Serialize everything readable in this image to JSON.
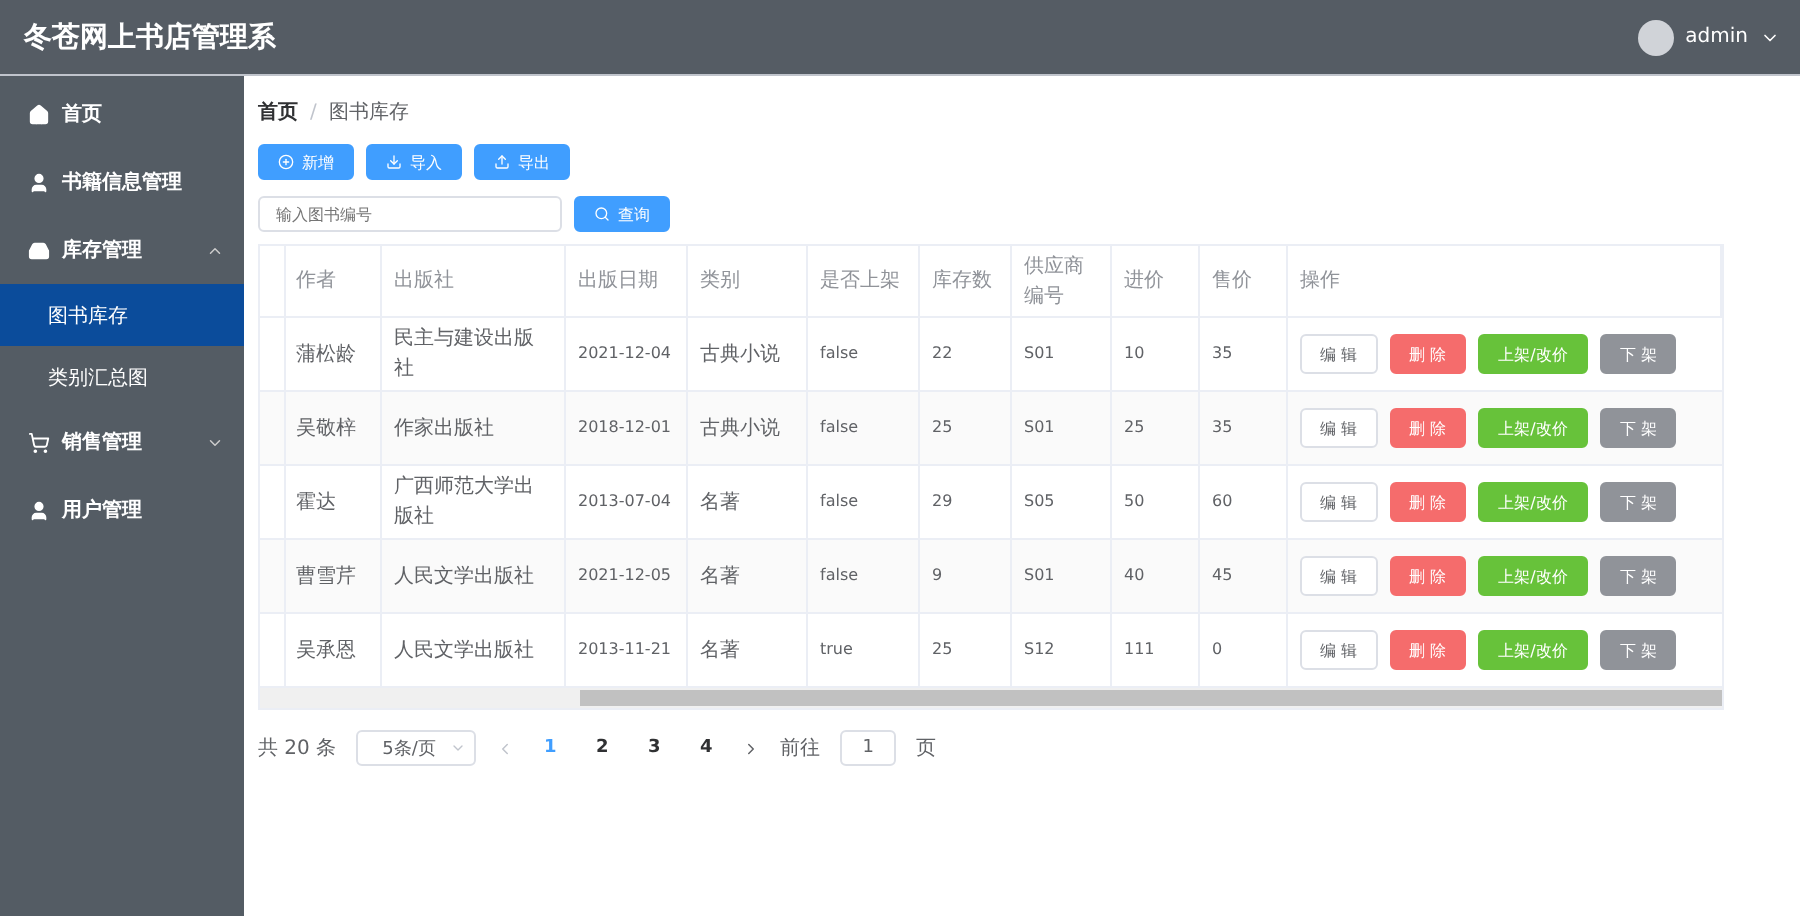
{
  "header": {
    "title": "冬苍网上书店管理系",
    "user": "admin"
  },
  "sidebar": {
    "items": [
      {
        "label": "首页",
        "kind": "home",
        "selected": false
      },
      {
        "label": "书籍信息管理",
        "kind": "user",
        "selected": false
      },
      {
        "label": "库存管理",
        "kind": "box",
        "selected": false,
        "expanded": true,
        "children": [
          {
            "label": "图书库存",
            "selected": true
          },
          {
            "label": "类别汇总图",
            "selected": false
          }
        ]
      },
      {
        "label": "销售管理",
        "kind": "cart",
        "selected": false,
        "expanded": false
      },
      {
        "label": "用户管理",
        "kind": "user",
        "selected": false
      }
    ]
  },
  "breadcrumb": {
    "separator": "/",
    "items": [
      "首页",
      "图书库存"
    ]
  },
  "toolbar": [
    {
      "label": "新增",
      "kind": "add"
    },
    {
      "label": "导入",
      "kind": "import"
    },
    {
      "label": "导出",
      "kind": "export"
    }
  ],
  "search": {
    "placeholder": "输入图书编号",
    "button": "查询"
  },
  "table": {
    "columns": [
      "作者",
      "出版社",
      "出版日期",
      "类别",
      "是否上架",
      "库存数",
      "供应商编号",
      "进价",
      "售价",
      "操作"
    ],
    "rows": [
      {
        "cells": [
          "蒲松龄",
          "民主与建设出版社",
          "2021-12-04",
          "古典小说",
          "false",
          "22",
          "S01",
          "10",
          "35"
        ],
        "actions": [
          {
            "label": "编 辑",
            "kind": "edit"
          },
          {
            "label": "删 除",
            "kind": "delete"
          },
          {
            "label": "上架/改价",
            "kind": "shelve"
          },
          {
            "label": "下 架",
            "kind": "unshelve"
          }
        ]
      },
      {
        "cells": [
          "吴敬梓",
          "作家出版社",
          "2018-12-01",
          "古典小说",
          "false",
          "25",
          "S01",
          "25",
          "35"
        ],
        "actions": [
          {
            "label": "编 辑",
            "kind": "edit"
          },
          {
            "label": "删 除",
            "kind": "delete"
          },
          {
            "label": "上架/改价",
            "kind": "shelve"
          },
          {
            "label": "下 架",
            "kind": "unshelve"
          }
        ]
      },
      {
        "cells": [
          "霍达",
          "广西师范大学出版社",
          "2013-07-04",
          "名著",
          "false",
          "29",
          "S05",
          "50",
          "60"
        ],
        "actions": [
          {
            "label": "编 辑",
            "kind": "edit"
          },
          {
            "label": "删 除",
            "kind": "delete"
          },
          {
            "label": "上架/改价",
            "kind": "shelve"
          },
          {
            "label": "下 架",
            "kind": "unshelve"
          }
        ]
      },
      {
        "cells": [
          "曹雪芹",
          "人民文学出版社",
          "2021-12-05",
          "名著",
          "false",
          "9",
          "S01",
          "40",
          "45"
        ],
        "actions": [
          {
            "label": "编 辑",
            "kind": "edit"
          },
          {
            "label": "删 除",
            "kind": "delete"
          },
          {
            "label": "上架/改价",
            "kind": "shelve"
          },
          {
            "label": "下 架",
            "kind": "unshelve"
          }
        ]
      },
      {
        "cells": [
          "吴承恩",
          "人民文学出版社",
          "2013-11-21",
          "名著",
          "true",
          "25",
          "S12",
          "111",
          "0"
        ],
        "actions": [
          {
            "label": "编 辑",
            "kind": "edit"
          },
          {
            "label": "删 除",
            "kind": "delete"
          },
          {
            "label": "上架/改价",
            "kind": "shelve"
          },
          {
            "label": "下 架",
            "kind": "unshelve"
          }
        ]
      }
    ]
  },
  "pagination": {
    "total": "共 20 条",
    "page_size": "5条/页",
    "pages": [
      {
        "label": "1",
        "selected": true
      },
      {
        "label": "2",
        "selected": false
      },
      {
        "label": "3",
        "selected": false
      },
      {
        "label": "4",
        "selected": false
      }
    ],
    "goto_label": "前往",
    "goto_value": "1",
    "goto_suffix": "页"
  }
}
